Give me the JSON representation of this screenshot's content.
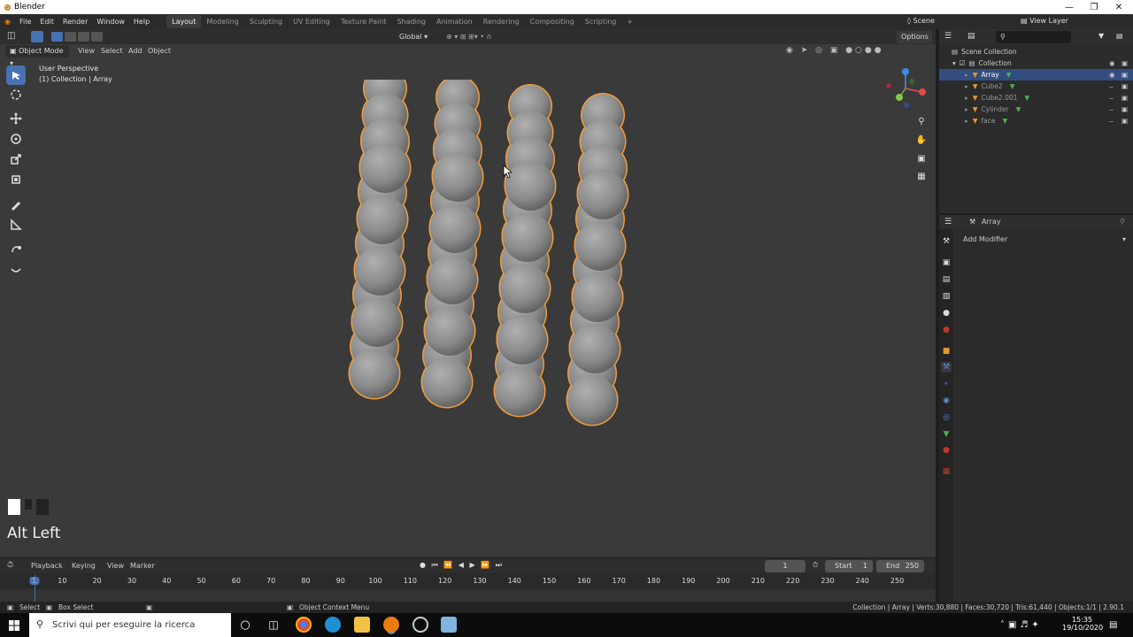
{
  "window": {
    "title": "Blender"
  },
  "menu": {
    "items": [
      "File",
      "Edit",
      "Render",
      "Window",
      "Help"
    ]
  },
  "workspaces": [
    "Layout",
    "Modeling",
    "Sculpting",
    "UV Editing",
    "Texture Paint",
    "Shading",
    "Animation",
    "Rendering",
    "Compositing",
    "Scripting"
  ],
  "workspace_active": "Layout",
  "scene": {
    "name": "Scene",
    "view_layer": "View Layer"
  },
  "viewport": {
    "header": {
      "transform_orientation": "Global",
      "options": "Options"
    },
    "mode": "Object Mode",
    "menus": [
      "View",
      "Select",
      "Add",
      "Object"
    ],
    "overlay_text": {
      "perspective": "User Perspective",
      "collection": "(1) Collection | Array"
    },
    "key_hint": "Alt Left"
  },
  "outliner": {
    "root": "Scene Collection",
    "collection": "Collection",
    "items": [
      {
        "name": "Array",
        "selected": true
      },
      {
        "name": "Cube2",
        "selected": false
      },
      {
        "name": "Cube2.001",
        "selected": false
      },
      {
        "name": "Cylinder",
        "selected": false
      },
      {
        "name": "face",
        "selected": false
      }
    ]
  },
  "properties": {
    "object": "Array",
    "add_modifier": "Add Modifier"
  },
  "timeline": {
    "menus": [
      "Playback",
      "Keying",
      "View",
      "Marker"
    ],
    "current_frame": "1",
    "start_label": "Start",
    "start": "1",
    "end_label": "End",
    "end": "250",
    "ticks": [
      "1",
      "10",
      "20",
      "30",
      "40",
      "50",
      "60",
      "70",
      "80",
      "90",
      "100",
      "110",
      "120",
      "130",
      "140",
      "150",
      "160",
      "170",
      "180",
      "190",
      "200",
      "210",
      "220",
      "230",
      "240",
      "250"
    ]
  },
  "statusbar": {
    "select": "Select",
    "box_select": "Box Select",
    "context_menu": "Object Context Menu",
    "stats": "Collection | Array | Verts:30,880 | Faces:30,720 | Tris:61,440 | Objects:1/1 | 2.90.1"
  },
  "taskbar": {
    "search_placeholder": "Scrivi qui per eseguire la ricerca",
    "time": "15:35",
    "date": "19/10/2020"
  },
  "colors": {
    "accent": "#4772b3",
    "selection_outline": "#f29d3d",
    "sphere": "#8a8a8a"
  }
}
